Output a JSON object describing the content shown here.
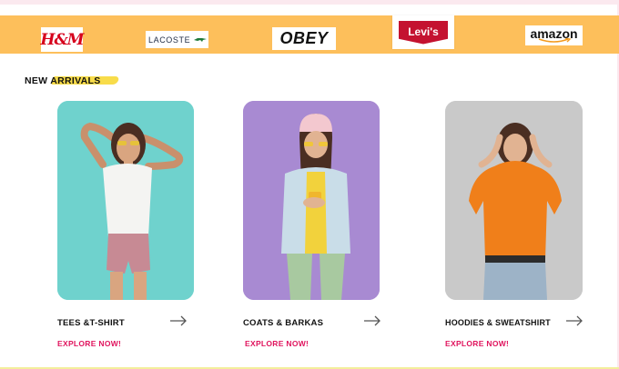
{
  "brands": {
    "hm": "H&M",
    "lacoste": "LACOSTE",
    "obey": "OBEY",
    "levis": "Levi's",
    "amazon": "amazon"
  },
  "section": {
    "title": "NEW ARRIVALS"
  },
  "cards": [
    {
      "label": "TEES  &T-SHIRT",
      "link": "EXPLORE NOW!",
      "image_icon": "woman-in-white-tee-photo"
    },
    {
      "label": "COATS & BARKAS",
      "link": "EXPLORE NOW!",
      "image_icon": "woman-in-denim-jacket-photo"
    },
    {
      "label": "HOODIES  & SWEATSHIRT",
      "link": "EXPLORE NOW!",
      "image_icon": "woman-in-orange-hoodie-photo"
    }
  ],
  "colors": {
    "brand_bar": "#fdbf5b",
    "accent_link": "#e0145e",
    "title_highlight": "#f8dc4a",
    "card_teal": "#6fd2cd",
    "card_purple": "#a88ad2",
    "card_grey": "#c9c9c9"
  }
}
